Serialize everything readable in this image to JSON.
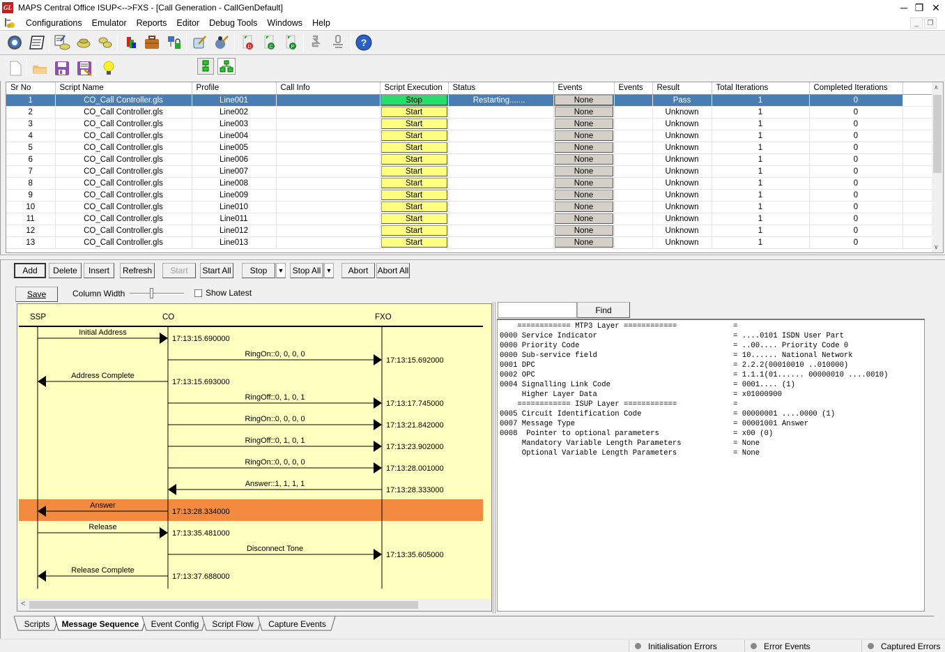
{
  "window": {
    "title": "MAPS Central Office ISUP<-->FXS - [Call Generation  - CallGenDefault]",
    "logo_text": "GL",
    "controls": {
      "minimize": "─",
      "restore": "❐",
      "close": "✕"
    },
    "mdi_controls": {
      "minimize": "_",
      "restore": "❐"
    }
  },
  "menu": {
    "items": [
      "Configurations",
      "Emulator",
      "Reports",
      "Editor",
      "Debug Tools",
      "Windows",
      "Help"
    ]
  },
  "toolbar1": {
    "icons": [
      "gear-settings-icon",
      "script-list-icon",
      "edit-profile-icon",
      "phone-icon",
      "phones-icon",
      "bulk-icon",
      "briefcase-icon",
      "network-lock-icon",
      "edit-check-icon",
      "wizard-icon",
      "doc-d-icon",
      "doc-c-icon",
      "doc-p-icon",
      "connect-icon",
      "disconnect-icon",
      "help-icon"
    ]
  },
  "toolbar2": {
    "icons": [
      "new-file-icon",
      "open-folder-icon",
      "save-icon",
      "save-as-icon",
      "lightbulb-icon",
      "single-view-icon",
      "tree-view-icon"
    ]
  },
  "grid": {
    "columns": [
      "Sr No",
      "Script Name",
      "Profile",
      "Call Info",
      "Script Execution",
      "Status",
      "Events",
      "Events",
      "Result",
      "Total Iterations",
      "Completed Iterations"
    ],
    "rows": [
      {
        "sr": "1",
        "script": "CO_Call Controller.gls",
        "profile": "Line001",
        "call_info": "",
        "exec": "Stop",
        "status": "Restarting.......",
        "events": "None",
        "events2": "",
        "result": "Pass",
        "total": "1",
        "completed": "0",
        "selected": true
      },
      {
        "sr": "2",
        "script": "CO_Call Controller.gls",
        "profile": "Line002",
        "call_info": "",
        "exec": "Start",
        "status": "",
        "events": "None",
        "events2": "",
        "result": "Unknown",
        "total": "1",
        "completed": "0"
      },
      {
        "sr": "3",
        "script": "CO_Call Controller.gls",
        "profile": "Line003",
        "call_info": "",
        "exec": "Start",
        "status": "",
        "events": "None",
        "events2": "",
        "result": "Unknown",
        "total": "1",
        "completed": "0"
      },
      {
        "sr": "4",
        "script": "CO_Call Controller.gls",
        "profile": "Line004",
        "call_info": "",
        "exec": "Start",
        "status": "",
        "events": "None",
        "events2": "",
        "result": "Unknown",
        "total": "1",
        "completed": "0"
      },
      {
        "sr": "5",
        "script": "CO_Call Controller.gls",
        "profile": "Line005",
        "call_info": "",
        "exec": "Start",
        "status": "",
        "events": "None",
        "events2": "",
        "result": "Unknown",
        "total": "1",
        "completed": "0"
      },
      {
        "sr": "6",
        "script": "CO_Call Controller.gls",
        "profile": "Line006",
        "call_info": "",
        "exec": "Start",
        "status": "",
        "events": "None",
        "events2": "",
        "result": "Unknown",
        "total": "1",
        "completed": "0"
      },
      {
        "sr": "7",
        "script": "CO_Call Controller.gls",
        "profile": "Line007",
        "call_info": "",
        "exec": "Start",
        "status": "",
        "events": "None",
        "events2": "",
        "result": "Unknown",
        "total": "1",
        "completed": "0"
      },
      {
        "sr": "8",
        "script": "CO_Call Controller.gls",
        "profile": "Line008",
        "call_info": "",
        "exec": "Start",
        "status": "",
        "events": "None",
        "events2": "",
        "result": "Unknown",
        "total": "1",
        "completed": "0"
      },
      {
        "sr": "9",
        "script": "CO_Call Controller.gls",
        "profile": "Line009",
        "call_info": "",
        "exec": "Start",
        "status": "",
        "events": "None",
        "events2": "",
        "result": "Unknown",
        "total": "1",
        "completed": "0"
      },
      {
        "sr": "10",
        "script": "CO_Call Controller.gls",
        "profile": "Line010",
        "call_info": "",
        "exec": "Start",
        "status": "",
        "events": "None",
        "events2": "",
        "result": "Unknown",
        "total": "1",
        "completed": "0"
      },
      {
        "sr": "11",
        "script": "CO_Call Controller.gls",
        "profile": "Line011",
        "call_info": "",
        "exec": "Start",
        "status": "",
        "events": "None",
        "events2": "",
        "result": "Unknown",
        "total": "1",
        "completed": "0"
      },
      {
        "sr": "12",
        "script": "CO_Call Controller.gls",
        "profile": "Line012",
        "call_info": "",
        "exec": "Start",
        "status": "",
        "events": "None",
        "events2": "",
        "result": "Unknown",
        "total": "1",
        "completed": "0"
      },
      {
        "sr": "13",
        "script": "CO_Call Controller.gls",
        "profile": "Line013",
        "call_info": "",
        "exec": "Start",
        "status": "",
        "events": "None",
        "events2": "",
        "result": "Unknown",
        "total": "1",
        "completed": "0"
      }
    ]
  },
  "actions": {
    "add": "Add",
    "delete": "Delete",
    "insert": "Insert",
    "refresh": "Refresh",
    "start": "Start",
    "start_all": "Start All",
    "stop": "Stop",
    "stop_all": "Stop All",
    "abort": "Abort",
    "abort_all": "Abort All",
    "dropdown_glyph": "▼"
  },
  "sequence_controls": {
    "save": "Save",
    "column_width_label": "Column Width",
    "show_latest_label": "Show Latest",
    "show_latest_checked": false
  },
  "sequence": {
    "entities": [
      "SSP",
      "CO",
      "FXO"
    ],
    "messages": [
      {
        "label": "Initial Address",
        "from": "SSP",
        "to": "CO",
        "time": "17:13:15.690000"
      },
      {
        "label": "RingOn::0, 0, 0, 0",
        "from": "CO",
        "to": "FXO",
        "time": "17:13:15.692000"
      },
      {
        "label": "Address Complete",
        "from": "CO",
        "to": "SSP",
        "time": "17:13:15.693000"
      },
      {
        "label": "RingOff::0, 1, 0, 1",
        "from": "CO",
        "to": "FXO",
        "time": "17:13:17.745000"
      },
      {
        "label": "RingOn::0, 0, 0, 0",
        "from": "CO",
        "to": "FXO",
        "time": "17:13:21.842000"
      },
      {
        "label": "RingOff::0, 1, 0, 1",
        "from": "CO",
        "to": "FXO",
        "time": "17:13:23.902000"
      },
      {
        "label": "RingOn::0, 0, 0, 0",
        "from": "CO",
        "to": "FXO",
        "time": "17:13:28.001000"
      },
      {
        "label": "Answer::1, 1, 1, 1",
        "from": "FXO",
        "to": "CO",
        "time": "17:13:28.333000"
      },
      {
        "label": "Answer",
        "from": "CO",
        "to": "SSP",
        "time": "17:13:28.334000",
        "highlighted": true
      },
      {
        "label": "Release",
        "from": "SSP",
        "to": "CO",
        "time": "17:13:35.481000"
      },
      {
        "label": "Disconnect Tone",
        "from": "CO",
        "to": "FXO",
        "time": "17:13:35.605000"
      },
      {
        "label": "Release Complete",
        "from": "CO",
        "to": "SSP",
        "time": "17:13:37.688000"
      }
    ],
    "highlight_color": "#f28a40",
    "background_color": "#ffffc0",
    "scroll_left_glyph": "<"
  },
  "decode": {
    "find_input_value": "",
    "find_button": "Find",
    "lines": [
      {
        "k": "    ============ MTP3 Layer ============",
        "v": "="
      },
      {
        "k": "0000 Service Indicator",
        "v": "= ....0101 ISDN User Part"
      },
      {
        "k": "0000 Priority Code",
        "v": "= ..00.... Priority Code 0"
      },
      {
        "k": "0000 Sub-service field",
        "v": "= 10...... National Network"
      },
      {
        "k": "0001 DPC",
        "v": "= 2.2.2(00010010 ..010000)"
      },
      {
        "k": "0002 OPC",
        "v": "= 1.1.1(01...... 00000010 ....0010)"
      },
      {
        "k": "0004 Signalling Link Code",
        "v": "= 0001.... (1)"
      },
      {
        "k": "     Higher Layer Data",
        "v": "= x01000900"
      },
      {
        "k": "    ============ ISUP Layer ============",
        "v": "="
      },
      {
        "k": "0005 Circuit Identification Code",
        "v": "= 00000001 ....0000 (1)"
      },
      {
        "k": "0007 Message Type",
        "v": "= 00001001 Answer"
      },
      {
        "k": "0008  Pointer to optional parameters",
        "v": "= x00 (0)"
      },
      {
        "k": "     Mandatory Variable Length Parameters",
        "v": "= None"
      },
      {
        "k": "     Optional Variable Length Parameters",
        "v": "= None"
      }
    ]
  },
  "tabs": {
    "items": [
      "Scripts",
      "Message Sequence",
      "Event Config",
      "Script Flow",
      "Capture Events"
    ],
    "active": "Message Sequence"
  },
  "statusbar": {
    "items": [
      "Initialisation Errors",
      "Error Events",
      "Captured Errors"
    ]
  },
  "colors": {
    "selection": "#4a7db4",
    "start_button": "#ffff80",
    "stop_button": "#22e06a",
    "events_button": "#d4d0c8"
  }
}
